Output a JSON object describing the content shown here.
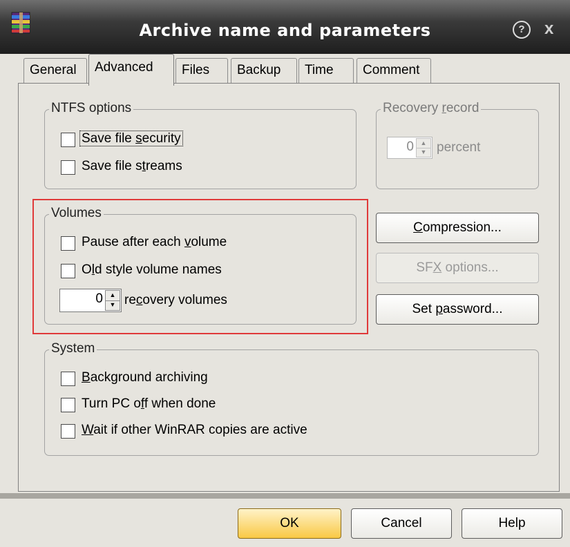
{
  "window": {
    "title": "Archive name and parameters",
    "help_glyph": "?",
    "close_glyph": "x"
  },
  "tabs": [
    {
      "label": "General"
    },
    {
      "label": "Advanced"
    },
    {
      "label": "Files"
    },
    {
      "label": "Backup"
    },
    {
      "label": "Time"
    },
    {
      "label": "Comment"
    }
  ],
  "active_tab": "Advanced",
  "ntfs": {
    "title": "NTFS options",
    "save_security": {
      "pre": "Save file ",
      "key": "s",
      "post": "ecurity",
      "checked": false
    },
    "save_streams": {
      "pre": "Save file s",
      "key": "t",
      "post": "reams",
      "checked": false
    }
  },
  "recovery_record": {
    "title_pre": "Recovery ",
    "title_key": "r",
    "title_post": "ecord",
    "value": "0",
    "unit": "percent",
    "disabled": true
  },
  "volumes": {
    "title": "Volumes",
    "pause": {
      "pre": "Pause after each ",
      "key": "v",
      "post": "olume",
      "checked": false
    },
    "old_style": {
      "pre": "O",
      "key": "l",
      "post": "d style volume names",
      "checked": false
    },
    "recovery_value": "0",
    "recovery_label_pre": "re",
    "recovery_label_key": "c",
    "recovery_label_post": "overy volumes"
  },
  "side_buttons": {
    "compression": {
      "key": "C",
      "rest": "ompression..."
    },
    "sfx": {
      "pre": "SF",
      "key": "X",
      "post": " options...",
      "disabled": true
    },
    "password": {
      "pre": "Set ",
      "key": "p",
      "post": "assword..."
    }
  },
  "system": {
    "title": "System",
    "background": {
      "key": "B",
      "post": "ackground archiving",
      "checked": false
    },
    "turn_off": {
      "pre": "Turn PC o",
      "key": "f",
      "post": "f when done",
      "checked": false
    },
    "wait": {
      "key": "W",
      "post": "ait if other WinRAR copies are active",
      "checked": false
    }
  },
  "footer": {
    "ok": "OK",
    "cancel": "Cancel",
    "help": "Help"
  },
  "colors": {
    "titlebar": "#2a2a2a",
    "dialog_bg": "#e6e4de",
    "ok_button": "#f9c945",
    "highlight_border": "#e03a3a"
  }
}
